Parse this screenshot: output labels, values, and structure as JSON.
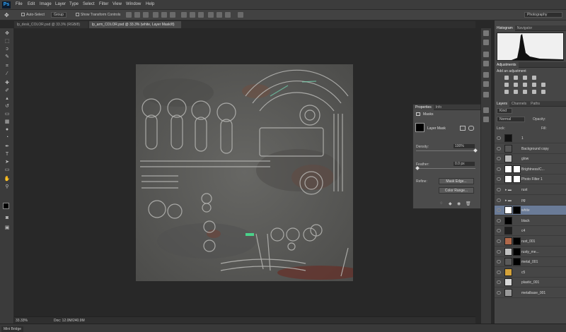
{
  "app": {
    "logo": "Ps"
  },
  "menu": [
    "File",
    "Edit",
    "Image",
    "Layer",
    "Type",
    "Select",
    "Filter",
    "View",
    "Window",
    "Help"
  ],
  "options": {
    "auto_select_label": "Auto-Select",
    "auto_select_value": "Group",
    "show_transform_label": "Show Transform Controls",
    "workspace": "Photography"
  },
  "tabs": [
    {
      "label": "lp_desk_COLOR.psd @ 33.3% (RGB/8)",
      "active": false
    },
    {
      "label": "lp_arm_COLOR.psd @ 33.3% (white, Layer Mask/8)",
      "active": true
    }
  ],
  "tools": [
    "move",
    "marquee",
    "lasso",
    "quick-select",
    "crop",
    "eyedropper",
    "healing",
    "brush",
    "clone",
    "history",
    "eraser",
    "gradient",
    "blur",
    "dodge",
    "pen",
    "type",
    "path-select",
    "shape",
    "hand",
    "zoom"
  ],
  "status": {
    "zoom": "33.33%",
    "doc": "Doc: 12.0M/240.9M"
  },
  "bottom": {
    "label": "Mini Bridge"
  },
  "histogram_panel": {
    "tabs": [
      "Histogram",
      "Navigator"
    ]
  },
  "adjustments_panel": {
    "title": "Adjustments",
    "hint": "Add an adjustment"
  },
  "properties_panel": {
    "tabs": [
      "Properties",
      "Info"
    ],
    "section": "Masks",
    "mask_label": "Layer Mask",
    "density_label": "Density:",
    "density_value": "100%",
    "density_fraction": 1.0,
    "feather_label": "Feather:",
    "feather_value": "0.0 px",
    "feather_fraction": 0.0,
    "refine_label": "Refine:",
    "mask_edge_button": "Mask Edge...",
    "color_range_button": "Color Range..."
  },
  "layers_panel": {
    "tabs": [
      "Layers",
      "Channels",
      "Paths"
    ],
    "filter": "Kind",
    "blend": "Normal",
    "opacity_label": "Opacity:",
    "lock_label": "Lock:",
    "fill_label": "Fill:",
    "layers": [
      {
        "name": "1",
        "thumb": "#111111",
        "selected": false,
        "type": "layer"
      },
      {
        "name": "Background copy",
        "thumb": "#555555",
        "selected": false,
        "type": "layer"
      },
      {
        "name": "glow",
        "thumb": "#bbbbbb",
        "selected": false,
        "type": "layer"
      },
      {
        "name": "Brightness/C...",
        "thumb": "#ffffff",
        "selected": false,
        "type": "adjustment"
      },
      {
        "name": "Photo Filter 1",
        "thumb": "#ffffff",
        "selected": false,
        "type": "adjustment"
      },
      {
        "name": "rust",
        "thumb": "",
        "selected": false,
        "type": "group"
      },
      {
        "name": "pg",
        "thumb": "",
        "selected": false,
        "type": "group"
      },
      {
        "name": "white",
        "thumb": "#ffffff",
        "selected": true,
        "type": "masked"
      },
      {
        "name": "black",
        "thumb": "#000000",
        "selected": false,
        "type": "layer"
      },
      {
        "name": "c4",
        "thumb": "#1e1e1e",
        "selected": false,
        "type": "layer"
      },
      {
        "name": "rust_001",
        "thumb": "#b0684a",
        "selected": false,
        "type": "masked"
      },
      {
        "name": "rusty_me...",
        "thumb": "#c0c0c0",
        "selected": false,
        "type": "masked"
      },
      {
        "name": "metal_001",
        "thumb": "#5a5a5a",
        "selected": false,
        "type": "masked"
      },
      {
        "name": "c5",
        "thumb": "#d4a23a",
        "selected": false,
        "type": "layer"
      },
      {
        "name": "plastic_001",
        "thumb": "#d8d8d8",
        "selected": false,
        "type": "layer"
      },
      {
        "name": "metalbase_001",
        "thumb": "#9a9a9a",
        "selected": false,
        "type": "layer"
      }
    ]
  },
  "canvas": {
    "label_tag": "tag"
  }
}
